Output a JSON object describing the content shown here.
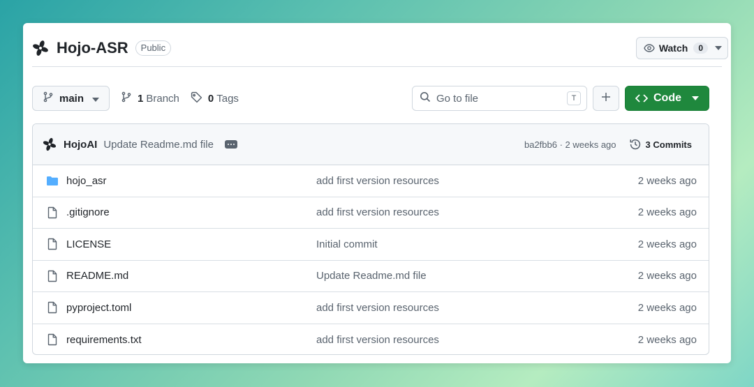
{
  "repo": {
    "title": "Hojo-ASR",
    "visibility": "Public",
    "watch_label": "Watch",
    "watch_count": "0"
  },
  "toolbar": {
    "branch": "main",
    "branches_count": "1",
    "branches_label": "Branch",
    "tags_count": "0",
    "tags_label": "Tags",
    "search_placeholder": "Go to file",
    "search_shortcut": "T",
    "code_label": "Code"
  },
  "latest_commit": {
    "author": "HojoAI",
    "message": "Update Readme.md file",
    "sha_time": "ba2fbb6 · 2 weeks ago",
    "commits_label": "3 Commits"
  },
  "files": [
    {
      "name": "hojo_asr",
      "type": "folder",
      "message": "add first version resources",
      "date": "2 weeks ago"
    },
    {
      "name": ".gitignore",
      "type": "file",
      "message": "add first version resources",
      "date": "2 weeks ago"
    },
    {
      "name": "LICENSE",
      "type": "file",
      "message": "Initial commit",
      "date": "2 weeks ago"
    },
    {
      "name": "README.md",
      "type": "file",
      "message": "Update Readme.md file",
      "date": "2 weeks ago"
    },
    {
      "name": "pyproject.toml",
      "type": "file",
      "message": "add first version resources",
      "date": "2 weeks ago"
    },
    {
      "name": "requirements.txt",
      "type": "file",
      "message": "add first version resources",
      "date": "2 weeks ago"
    }
  ],
  "colors": {
    "accent_green": "#1f883d",
    "folder_blue": "#54aeff",
    "muted_text": "#59636e"
  }
}
